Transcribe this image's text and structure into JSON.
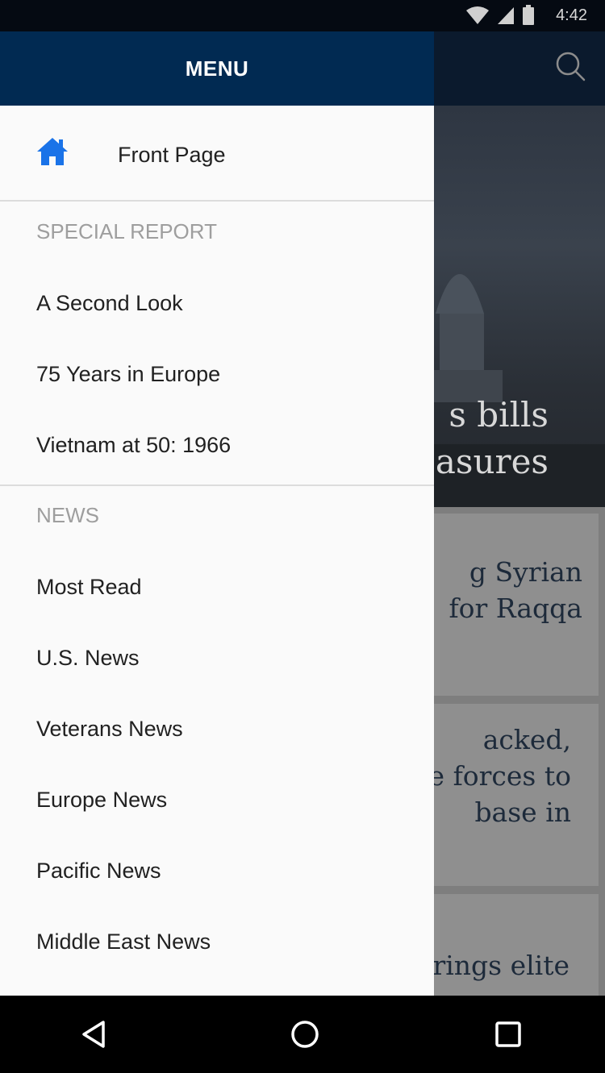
{
  "status_bar": {
    "time": "4:42",
    "icons": [
      "wifi-icon",
      "cell-signal-icon",
      "battery-icon"
    ]
  },
  "background_app": {
    "hero_headline": "s bills\nasures",
    "cards": [
      {
        "headline": "g Syrian\nfor Raqqa"
      },
      {
        "headline": "acked,\ne forces to\nbase in"
      },
      {
        "headline": "rings elite"
      }
    ],
    "search_icon": "search-icon"
  },
  "drawer": {
    "title": "MENU",
    "front_page": {
      "label": "Front Page",
      "icon": "home-icon",
      "icon_color": "#1a73e8"
    },
    "sections": [
      {
        "header": "SPECIAL REPORT",
        "items": [
          "A Second Look",
          "75 Years in Europe",
          "Vietnam at 50: 1966"
        ]
      },
      {
        "header": "NEWS",
        "items": [
          "Most Read",
          "U.S. News",
          "Veterans News",
          "Europe News",
          "Pacific News",
          "Middle East News"
        ]
      }
    ]
  },
  "nav_bar": {
    "buttons": [
      "back-icon",
      "home-circle-icon",
      "recents-icon"
    ]
  },
  "colors": {
    "drawer_header": "#012a52",
    "drawer_background": "#fafafa",
    "accent": "#1a73e8",
    "section_header_text": "#9e9e9e"
  }
}
